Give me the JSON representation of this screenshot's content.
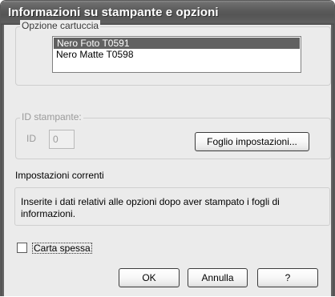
{
  "window": {
    "title": "Informazioni su stampante e opzioni"
  },
  "cartridge_group": {
    "legend": "Opzione cartuccia",
    "items": [
      {
        "label": "Nero Foto T0591",
        "selected": true
      },
      {
        "label": "Nero Matte T0598",
        "selected": false
      }
    ]
  },
  "printer_id_group": {
    "legend": "ID stampante:",
    "id_label": "ID",
    "id_value": "0",
    "settings_button": "Foglio impostazioni...",
    "enabled": false
  },
  "current_settings": {
    "label": "Impostazioni correnti",
    "message": "Inserite i dati relativi alle opzioni dopo aver stampato i fogli di informazioni."
  },
  "thick_paper": {
    "label": "Carta spessa",
    "checked": false
  },
  "buttons": {
    "ok": "OK",
    "cancel": "Annulla",
    "help": "?"
  },
  "colors": {
    "titlebar": "#5b5b5b",
    "selection": "#616161",
    "dialog_bg": "#ececec"
  }
}
